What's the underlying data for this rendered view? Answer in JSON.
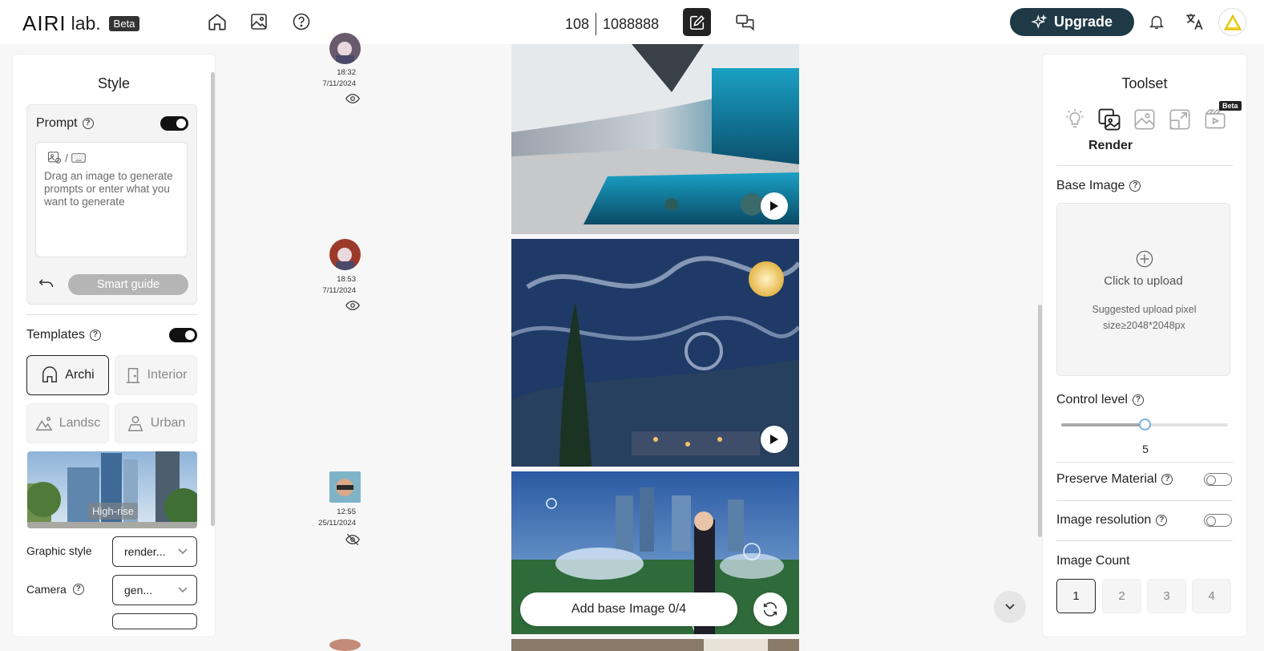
{
  "header": {
    "logo_text": "AIRI",
    "logo_suffix": "lab.",
    "beta_badge": "Beta",
    "credits_left": "108",
    "credits_right": "1088888",
    "upgrade_label": "Upgrade"
  },
  "left_panel": {
    "title": "Style",
    "prompt_label": "Prompt",
    "prompt_toggle_on": true,
    "prompt_placeholder": "Drag an image to generate prompts or enter what you want to generate",
    "prompt_icon_separator": "/",
    "smart_guide_label": "Smart guide",
    "templates_label": "Templates",
    "templates_toggle_on": true,
    "templates": [
      {
        "label": "Archi",
        "icon": "house-icon",
        "active": true
      },
      {
        "label": "Interior",
        "icon": "door-icon",
        "active": false
      },
      {
        "label": "Landsc",
        "icon": "landscape-icon",
        "active": false
      },
      {
        "label": "Urban",
        "icon": "person-icon",
        "active": false
      }
    ],
    "template_image_label": "High-rise",
    "graphic_style_label": "Graphic style",
    "graphic_style_value": "render...",
    "camera_label": "Camera",
    "camera_value": "gen..."
  },
  "feed": {
    "items": [
      {
        "time": "18:32",
        "date": "7/11/2024",
        "visibility": "eye-icon"
      },
      {
        "time": "18:53",
        "date": "7/11/2024",
        "visibility": "eye-icon"
      },
      {
        "time": "12:55",
        "date": "25/11/2024",
        "visibility": "eye-off-icon"
      }
    ],
    "add_base_label": "Add base Image 0/4"
  },
  "right_panel": {
    "title": "Toolset",
    "active_tool_label": "Render",
    "beta_badge": "Beta",
    "tools": [
      "lightbulb-icon",
      "render-icon",
      "image-icon",
      "expand-icon",
      "video-icon"
    ],
    "base_image_label": "Base Image",
    "upload_label": "Click to upload",
    "upload_hint": "Suggested upload pixel size≥2048*2048px",
    "control_level_label": "Control level",
    "control_level_value": "5",
    "control_level_fraction": 0.5,
    "preserve_material_label": "Preserve Material",
    "preserve_material_on": false,
    "image_resolution_label": "Image resolution",
    "image_resolution_on": false,
    "image_count_label": "Image Count",
    "image_count_options": [
      "1",
      "2",
      "3",
      "4"
    ],
    "image_count_selected": "1"
  },
  "colors": {
    "upgrade_bg": "#1f3a46",
    "slider_thumb": "#7ab3e0",
    "accent_dark": "#222222"
  }
}
